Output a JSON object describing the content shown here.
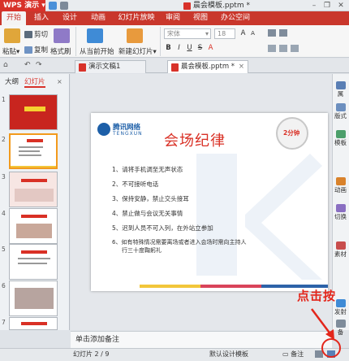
{
  "app": {
    "logo_label": "WPS 演示",
    "window_title": "晨会模板.pptm *",
    "window_controls": [
      "minimize-icon",
      "restore-icon",
      "close-icon"
    ]
  },
  "menu": {
    "items": [
      "开始",
      "插入",
      "设计",
      "动画",
      "幻灯片放映",
      "审阅",
      "视图",
      "办公空间"
    ]
  },
  "ribbon": {
    "paste": "粘贴",
    "cut": "剪切",
    "copy": "复制",
    "format_painter": "格式刷",
    "play_from_current": "从当前开始",
    "new_slide": "新建幻灯片",
    "font_name": "宋体",
    "font_size": "18",
    "format_buttons": [
      "B",
      "I",
      "U",
      "S",
      "A"
    ]
  },
  "tabs": {
    "items": [
      {
        "label": "演示文稿1"
      },
      {
        "label": "晨会模板.pptm *"
      }
    ]
  },
  "left_panel": {
    "tabs": [
      "大纲",
      "幻灯片"
    ],
    "thumb_numbers": [
      "1",
      "2",
      "3",
      "4",
      "5",
      "6",
      "7"
    ]
  },
  "slide": {
    "logo_name": "腾讯网络",
    "logo_sub": "TENGXUN",
    "title": "会场纪律",
    "clock_badge": "2分钟",
    "bullets": [
      "1、请将手机调至无声状态",
      "2、不可接听电话",
      "3、保持安静，禁止交头接耳",
      "4、禁止做与会议无关事情",
      "5、迟到人员不可入列，在外站立参加",
      "6、如有特殊情况需要离场或者进入会场时需向主持人",
      "行三十度鞠躬礼"
    ]
  },
  "right_bar": {
    "items": [
      "属",
      "版式",
      "模板",
      "动画",
      "切换",
      "素材",
      "发射",
      "备"
    ]
  },
  "notes": {
    "placeholder": "单击添加备注"
  },
  "status": {
    "slide_counter": "幻灯片 2 / 9",
    "template": "默认设计模板",
    "notes_label": "备注"
  },
  "annotation": {
    "text": "点击按"
  },
  "colors": {
    "brand_red": "#c9372c",
    "accent_orange": "#f29a1d",
    "title_red": "#d93025",
    "logo_blue": "#1d5fa8"
  }
}
